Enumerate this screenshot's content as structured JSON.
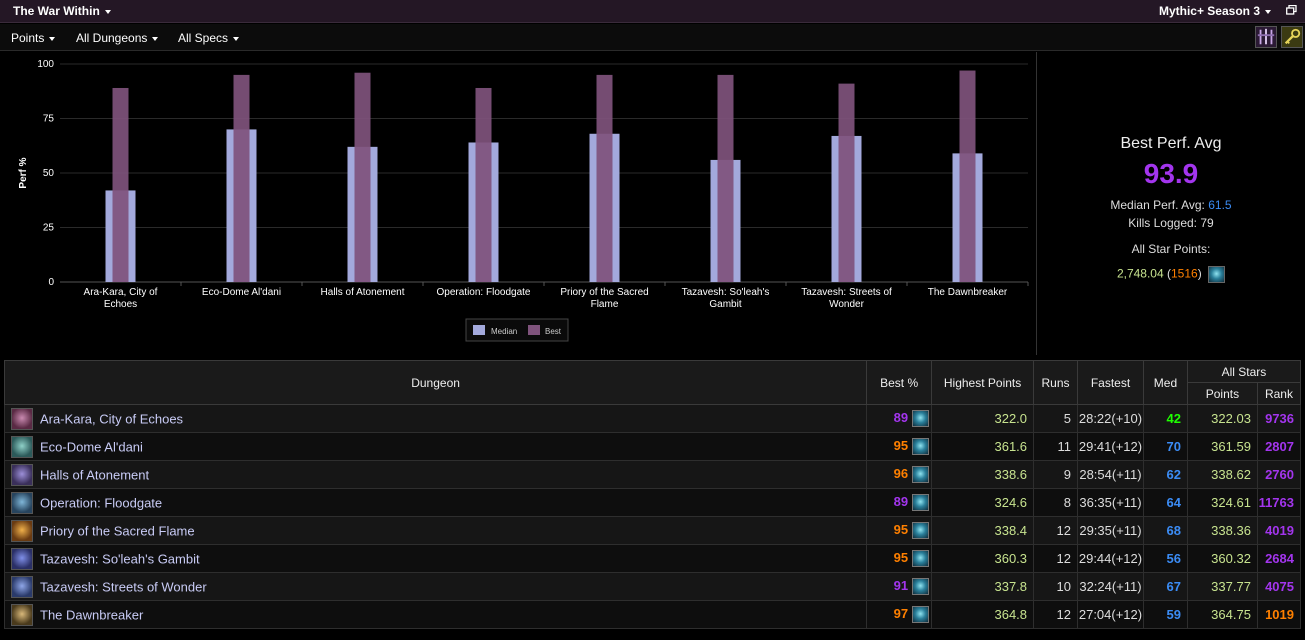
{
  "topbar": {
    "title": "The War Within",
    "season": "Mythic+ Season 3"
  },
  "filters": {
    "metric": "Points",
    "dungeons": "All Dungeons",
    "specs": "All Specs"
  },
  "chart_data": {
    "type": "bar",
    "ylabel": "Perf %",
    "xlabel": "",
    "ylim": [
      0,
      100
    ],
    "yticks": [
      0,
      25,
      50,
      75,
      100
    ],
    "grid": true,
    "legend_position": "bottom",
    "categories": [
      "Ara-Kara, City of Echoes",
      "Eco-Dome Al'dani",
      "Halls of Atonement",
      "Operation: Floodgate",
      "Priory of the Sacred Flame",
      "Tazavesh: So'leah's Gambit",
      "Tazavesh: Streets of Wonder",
      "The Dawnbreaker"
    ],
    "series": [
      {
        "name": "Median",
        "color": "#a3a9dc",
        "values": [
          42,
          70,
          62,
          64,
          68,
          56,
          67,
          59
        ]
      },
      {
        "name": "Best",
        "color": "#7f537c",
        "values": [
          89,
          95,
          96,
          89,
          95,
          95,
          91,
          97
        ]
      }
    ]
  },
  "summary": {
    "heading": "Best Perf. Avg",
    "best_avg": "93.9",
    "median_label": "Median Perf. Avg:",
    "median_value": "61.5",
    "kills_label": "Kills Logged:",
    "kills_value": "79",
    "allstar_label": "All Star Points:",
    "allstar_points": "2,748.04",
    "allstar_rank": "1516"
  },
  "table": {
    "headers": {
      "dungeon": "Dungeon",
      "best": "Best %",
      "highest": "Highest Points",
      "runs": "Runs",
      "fastest": "Fastest",
      "med": "Med",
      "allstars": "All Stars",
      "points": "Points",
      "rank": "Rank"
    },
    "rows": [
      {
        "name": "Ara-Kara, City of Echoes",
        "best": "89",
        "highest": "322.0",
        "runs": "5",
        "fastest": "28:22(+10)",
        "med": "42",
        "points": "322.03",
        "rank": "9736"
      },
      {
        "name": "Eco-Dome Al'dani",
        "best": "95",
        "highest": "361.6",
        "runs": "11",
        "fastest": "29:41(+12)",
        "med": "70",
        "points": "361.59",
        "rank": "2807"
      },
      {
        "name": "Halls of Atonement",
        "best": "96",
        "highest": "338.6",
        "runs": "9",
        "fastest": "28:54(+11)",
        "med": "62",
        "points": "338.62",
        "rank": "2760"
      },
      {
        "name": "Operation: Floodgate",
        "best": "89",
        "highest": "324.6",
        "runs": "8",
        "fastest": "36:35(+11)",
        "med": "64",
        "points": "324.61",
        "rank": "11763"
      },
      {
        "name": "Priory of the Sacred Flame",
        "best": "95",
        "highest": "338.4",
        "runs": "12",
        "fastest": "29:35(+11)",
        "med": "68",
        "points": "338.36",
        "rank": "4019"
      },
      {
        "name": "Tazavesh: So'leah's Gambit",
        "best": "95",
        "highest": "360.3",
        "runs": "12",
        "fastest": "29:44(+12)",
        "med": "56",
        "points": "360.32",
        "rank": "2684"
      },
      {
        "name": "Tazavesh: Streets of Wonder",
        "best": "91",
        "highest": "337.8",
        "runs": "10",
        "fastest": "32:24(+11)",
        "med": "67",
        "points": "337.77",
        "rank": "4075"
      },
      {
        "name": "The Dawnbreaker",
        "best": "97",
        "highest": "364.8",
        "runs": "12",
        "fastest": "27:04(+12)",
        "med": "59",
        "points": "364.75",
        "rank": "1019"
      }
    ]
  },
  "colors": {
    "epic": "#a335ee",
    "legendary": "#ff8000",
    "rare": "#3b8cf5",
    "uncommon": "#1eff00",
    "points": "#c7e38f",
    "dungeon_link": "#c8cbf5",
    "median_bar": "#a3a9dc",
    "best_bar": "#7f537c"
  },
  "icons": {
    "dungeon_icons": [
      "ara-kara-icon",
      "eco-dome-icon",
      "halls-of-atonement-icon",
      "floodgate-icon",
      "priory-icon",
      "soleah-gambit-icon",
      "streets-of-wonder-icon",
      "dawnbreaker-icon"
    ],
    "spec_icon": "frost-spec-icon",
    "toolbar": [
      "armory-icon",
      "keystone-icon"
    ]
  }
}
